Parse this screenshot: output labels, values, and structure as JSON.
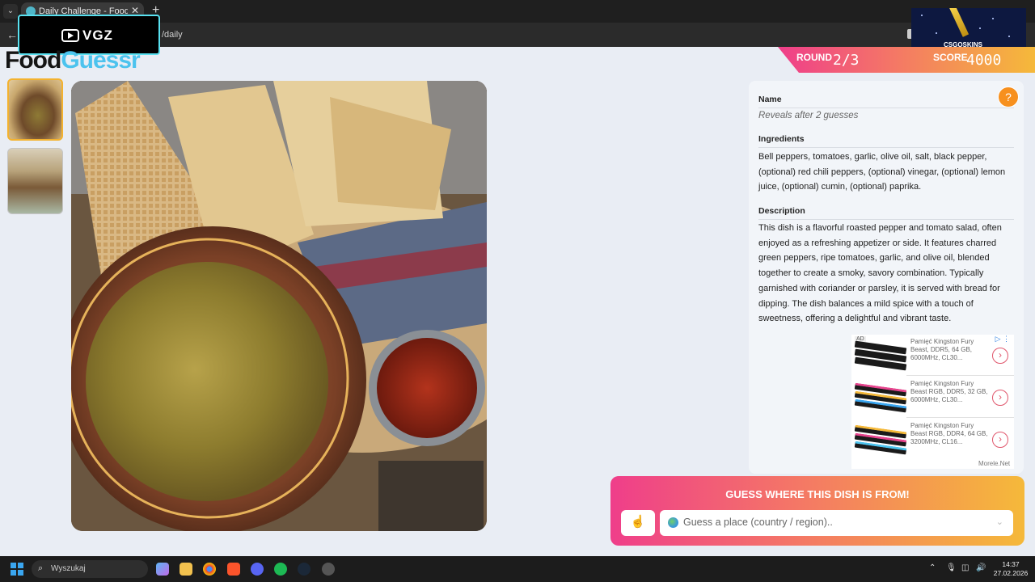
{
  "browser": {
    "tab_title": "Daily Challenge - FoodGuessr |",
    "tab_close": "✕",
    "new_tab": "+",
    "url": "/daily"
  },
  "overlays": {
    "vgz_text": "VGZ",
    "csgo_text": "CSGOSKINS"
  },
  "logo": {
    "part1": "Food",
    "part2": "Guessr"
  },
  "game": {
    "round_label": "ROUND",
    "round_value": "2/3",
    "score_label": "SCORE",
    "score_value": "4000"
  },
  "info": {
    "help": "?",
    "name_label": "Name",
    "name_value": "Reveals after 2 guesses",
    "ingredients_label": "Ingredients",
    "ingredients_text": "Bell peppers, tomatoes, garlic, olive oil, salt, black pepper, (optional) red chili peppers, (optional) vinegar, (optional) lemon juice, (optional) cumin, (optional) paprika.",
    "description_label": "Description",
    "description_text": "This dish is a flavorful roasted pepper and tomato salad, often enjoyed as a refreshing appetizer or side. It features charred green peppers, ripe tomatoes, garlic, and olive oil, blended together to create a smoky, savory combination. Typically garnished with coriander or parsley, it is served with bread for dipping. The dish balances a mild spice with a touch of sweetness, offering a delightful and vibrant taste."
  },
  "ad": {
    "badge": "AD",
    "source": "Morele.Net",
    "items": [
      {
        "text": "Pamięć Kingston Fury Beast, DDR5, 64 GB, 6000MHz, CL30..."
      },
      {
        "text": "Pamięć Kingston Fury Beast RGB, DDR5, 32 GB, 6000MHz, CL30..."
      },
      {
        "text": "Pamięć Kingston Fury Beast RGB, DDR4, 64 GB, 3200MHz, CL16..."
      }
    ],
    "arrow": "›"
  },
  "guess": {
    "title": "GUESS WHERE THIS DISH IS FROM!",
    "hand_icon": "☝",
    "placeholder": "Guess a place (country / region)..",
    "chevron": "⌄"
  },
  "taskbar": {
    "search_text": "Wyszukaj",
    "time": "14:37",
    "date": "27.02.2026"
  },
  "colors": {
    "accent_gradient_start": "#ef3e8a",
    "accent_gradient_end": "#f5b93a",
    "logo_blue": "#4cc3ee",
    "help_orange": "#f7901e"
  }
}
